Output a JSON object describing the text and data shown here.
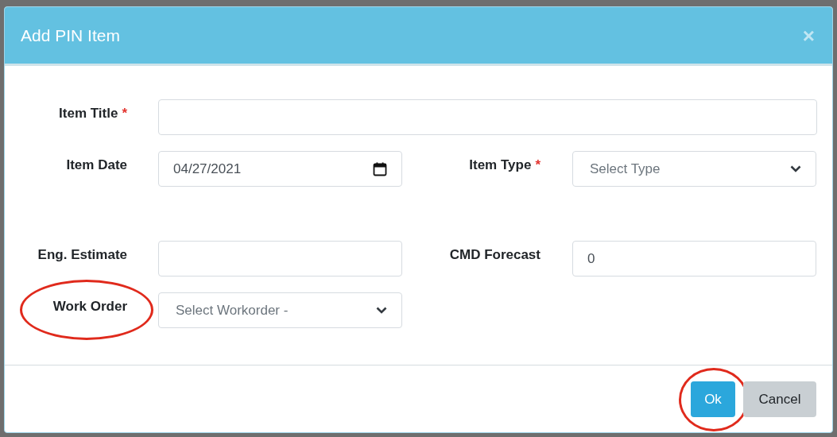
{
  "dialog": {
    "title": "Add PIN Item",
    "close": "×"
  },
  "rows": [
    [
      {
        "label": "Item Title",
        "required_mark": "*",
        "kind": "text",
        "wide": true
      }
    ],
    [
      {
        "label": "Item Date",
        "kind": "date",
        "value": "04/27/2021"
      },
      {
        "label": "Item Type",
        "required_mark": "*",
        "kind": "select",
        "placeholder": "Select Type"
      }
    ],
    [
      {
        "label": "Eng. Estimate",
        "kind": "text"
      },
      {
        "label": "CMD Forecast",
        "kind": "text",
        "value": "0"
      }
    ],
    [
      {
        "label": "Work Order",
        "kind": "select",
        "placeholder": "Select Workorder -",
        "highlighted": true
      }
    ]
  ],
  "buttons": [
    {
      "label": "Ok",
      "kind": "primary",
      "highlighted": true
    },
    {
      "label": "Cancel",
      "kind": "secondary"
    }
  ]
}
